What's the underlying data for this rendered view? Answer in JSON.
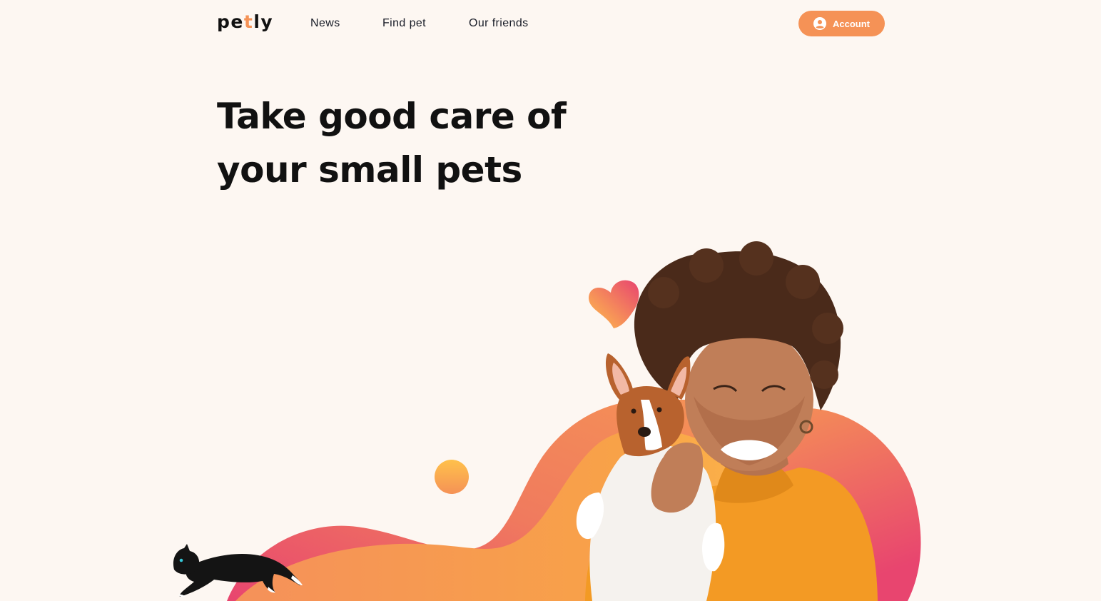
{
  "logo": {
    "prefix": "pe",
    "accent": "t",
    "suffix": "ly"
  },
  "nav": {
    "items": [
      {
        "label": "News"
      },
      {
        "label": "Find pet"
      },
      {
        "label": "Our friends"
      }
    ]
  },
  "account": {
    "label": "Account",
    "icon": "user-circle-icon"
  },
  "hero": {
    "title_line1": "Take good care of",
    "title_line2": "your small pets"
  },
  "colors": {
    "background": "#FDF7F2",
    "accent": "#F59256",
    "gradient_pink": "#E8456F",
    "gradient_orange": "#F59256",
    "gradient_yellow": "#FFC14B",
    "text": "#111111"
  }
}
